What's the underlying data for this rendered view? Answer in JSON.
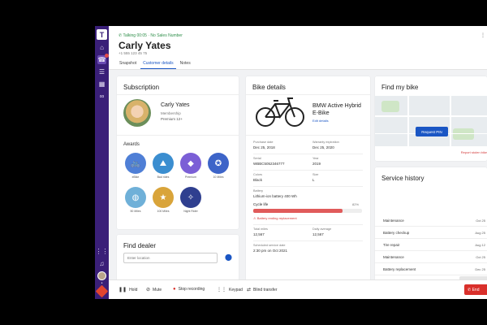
{
  "header": {
    "call_status": "Talking 00:05 · No Sales Number",
    "customer_name": "Carly Yates",
    "phone": "+1 555 123 45 75",
    "tabs": [
      {
        "label": "Snapshot",
        "active": false
      },
      {
        "label": "Customer details",
        "active": true
      },
      {
        "label": "Notes",
        "active": false
      }
    ]
  },
  "subscription": {
    "title": "Subscription",
    "name": "Carly Yates",
    "membership_label": "Membership",
    "membership_value": "Premium 12+",
    "awards_title": "Awards",
    "awards": [
      {
        "label": "eBike",
        "icon": "bike-icon"
      },
      {
        "label": "Bad rides",
        "icon": "mountain-icon"
      },
      {
        "label": "Premium",
        "icon": "diamond-icon"
      },
      {
        "label": "10 Miles",
        "icon": "mileage-icon"
      },
      {
        "label": "50 Miles",
        "icon": "globe-icon"
      },
      {
        "label": "100 Miles",
        "icon": "star-icon"
      },
      {
        "label": "Night Rider",
        "icon": "night-icon"
      }
    ]
  },
  "dealer": {
    "title": "Find dealer",
    "placeholder": "Enter location"
  },
  "bike": {
    "title": "Bike details",
    "model": "BMW Active Hybrid E-Bike",
    "link": "Edit details",
    "fields": [
      {
        "label": "Purchase date",
        "value": "Dec 25, 2018"
      },
      {
        "label": "Warranty expiration",
        "value": "Dec 25, 2020"
      },
      {
        "label": "Serial",
        "value": "WBBC5052346777"
      },
      {
        "label": "Year",
        "value": "2019"
      },
      {
        "label": "Colors",
        "value": "Black"
      },
      {
        "label": "Size",
        "value": "L"
      },
      {
        "label": "Battery",
        "value": "Lithium-ion battery 400 Wh"
      }
    ],
    "cycle_label": "Cycle life",
    "cycle_percent": "82%",
    "cycle_fill": 0.82,
    "cycle_warning": "Battery ending replacement",
    "stats": [
      {
        "label": "Total miles",
        "value": "12,567"
      },
      {
        "label": "Daily average",
        "value": "12,567"
      }
    ],
    "service_label": "Scheduled service date",
    "service_value": "2:30 pm on Oct 2021"
  },
  "map": {
    "title": "Find my bike",
    "button": "Request PIN",
    "report": "Report stolen bike"
  },
  "service": {
    "title": "Service history",
    "rows": [
      {
        "type": "Maintenance",
        "date": "Oct 25"
      },
      {
        "type": "Battery checkup",
        "date": "Aug 25"
      },
      {
        "type": "Tire repair",
        "date": "Aug 12"
      },
      {
        "type": "Maintenance",
        "date": "Oct 25"
      },
      {
        "type": "Battery replacement",
        "date": "Dec 25"
      }
    ],
    "button": "Show all history"
  },
  "bottom_bar": {
    "hold": "Hold",
    "mute": "Mute",
    "record": "Stop recording",
    "keypad": "Keypad",
    "transfer": "Blind transfer",
    "end": "End"
  },
  "colors": {
    "rail": "#3a1f78",
    "accent": "#1a56c4",
    "danger": "#d9302b",
    "call_green": "#2f8f4a"
  }
}
